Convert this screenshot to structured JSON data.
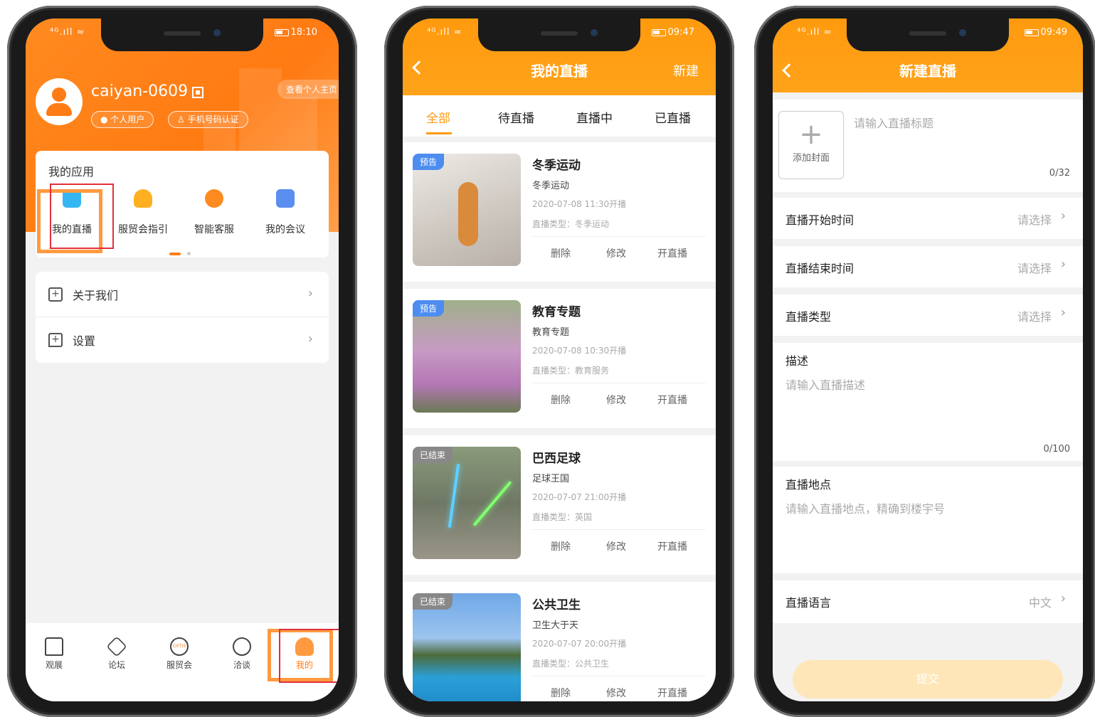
{
  "phone1": {
    "status": {
      "left": "⁴ᴳ.ıll ≈",
      "time": "18:10"
    },
    "profile": {
      "username": "caiyan-0609",
      "view_home": "查看个人主页",
      "tag_user": "● 个人用户",
      "tag_phone": "♙ 手机号码认证"
    },
    "apps": {
      "title": "我的应用",
      "items": [
        {
          "label": "我的直播",
          "color": "#35b6f0"
        },
        {
          "label": "服贸会指引",
          "color": "#ffb020"
        },
        {
          "label": "智能客服",
          "color": "#ff8a20"
        },
        {
          "label": "我的会议",
          "color": "#5a8ef0"
        }
      ]
    },
    "menu": [
      {
        "label": "关于我们",
        "icon": "+"
      },
      {
        "label": "设置",
        "icon": "+"
      }
    ],
    "tabbar": [
      {
        "label": "观展"
      },
      {
        "label": "论坛"
      },
      {
        "label": "服贸会",
        "sub": "CIFTIS"
      },
      {
        "label": "洽谈"
      },
      {
        "label": "我的"
      }
    ],
    "active_color": "#ff7b15"
  },
  "phone2": {
    "status": {
      "left": "⁴ᴳ.ıll ≈",
      "time": "09:47"
    },
    "nav": {
      "title": "我的直播",
      "action": "新建"
    },
    "tabs": [
      "全部",
      "待直播",
      "直播中",
      "已直播"
    ],
    "items": [
      {
        "badge": "预告",
        "badge_color": "#4d8df0",
        "title": "冬季运动",
        "sub": "冬季运动",
        "time": "2020-07-08 11:30开播",
        "type": "直播类型：冬季运动"
      },
      {
        "badge": "预告",
        "badge_color": "#4d8df0",
        "title": "教育专题",
        "sub": "教育专题",
        "time": "2020-07-08 10:30开播",
        "type": "直播类型：教育服务"
      },
      {
        "badge": "已结束",
        "badge_color": "#888888",
        "title": "巴西足球",
        "sub": "足球王国",
        "time": "2020-07-07 21:00开播",
        "type": "直播类型：英国"
      },
      {
        "badge": "已结束",
        "badge_color": "#888888",
        "title": "公共卫生",
        "sub": "卫生大于天",
        "time": "2020-07-07 20:00开播",
        "type": "直播类型：公共卫生"
      }
    ],
    "actions": [
      "删除",
      "修改",
      "开直播"
    ]
  },
  "phone3": {
    "status": {
      "left": "⁴ᴳ.ıll ≈",
      "time": "09:49"
    },
    "nav": {
      "title": "新建直播"
    },
    "cover_label": "添加封面",
    "title_placeholder": "请输入直播标题",
    "title_counter": "0/32",
    "rows": [
      {
        "label": "直播开始时间",
        "value": "请选择"
      },
      {
        "label": "直播结束时间",
        "value": "请选择"
      },
      {
        "label": "直播类型",
        "value": "请选择"
      }
    ],
    "desc": {
      "label": "描述",
      "placeholder": "请输入直播描述",
      "counter": "0/100"
    },
    "location": {
      "label": "直播地点",
      "placeholder": "请输入直播地点，精确到楼宇号"
    },
    "language": {
      "label": "直播语言",
      "value": "中文"
    },
    "submit": "提交"
  }
}
